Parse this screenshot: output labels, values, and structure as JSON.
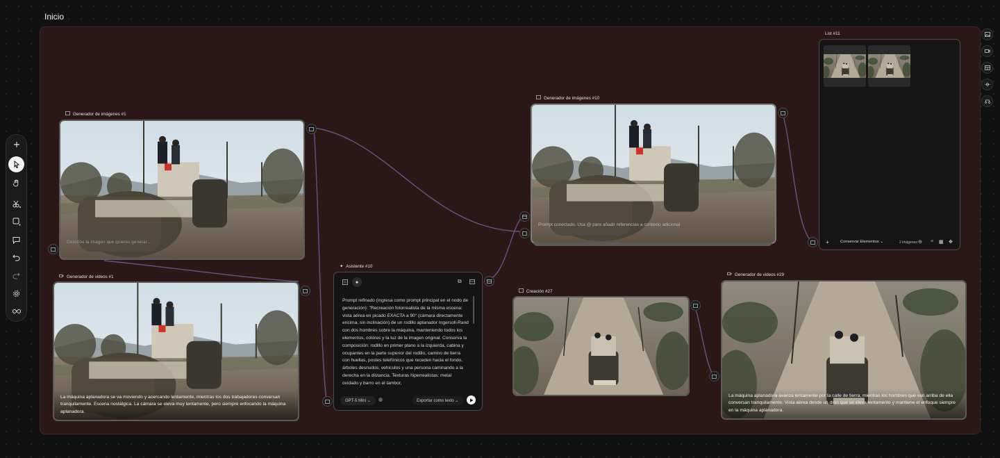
{
  "page_title": "Inicio",
  "nodes": {
    "img1": {
      "label": "Generador de imágenes #1",
      "placeholder": "Describe la imagen que quieres generar..."
    },
    "img10": {
      "label": "Generador de imágenes #10",
      "placeholder": "Prompt conectado. Usa @ para añadir referencias a contexto adicional"
    },
    "vid1": {
      "label": "Generador de videos #1",
      "caption": "La máquina aplanadora se va moviendo y acercando lentamente, mientras los dos trabajadores conversan tranquilamente. Escena nostálgica. La cámara se eleva muy lentamente, pero siempre enfocando la máquina aplanadora."
    },
    "creation27": {
      "label": "Creación #27"
    },
    "vid29": {
      "label": "Generador de videos #29",
      "caption": "La máquina aplanadora avanza lentamente por la calle de tierra, mientras los hombres que van arriba de ella conversan tranquilamente. Vista aérea desde un dron que se eleva lentamente y mantiene el enfoque siempre en la máquina aplanadora."
    }
  },
  "assistant": {
    "label": "Asistente #10",
    "text": "Prompt refinado (ingresa como prompt principal en el nodo de generación): \"Recreación fotorrealista de la misma escena: vista aérea en picado EXACTA a 90° (cámara directamente encima, sin inclinación) de un rodillo aplanador Ingersoll-Rand con dos hombres sobre la máquina, manteniendo todos los elementos, colores y la luz de la imagen original. Conserva la composición: rodillo en primer plano a la izquierda, cabina y ocupantes en la parte superior del rodillo, camino de tierra con huellas, postes telefónicos que receden hacia el fondo, árboles desnudos, vehículos y una persona caminando a la derecha en la distancia. Texturas hiperrealistas: metal oxidado y barro en el tambor,",
    "model": "GPT-5 Mini",
    "export_label": "Exportar como texto"
  },
  "list": {
    "label": "List #11",
    "keep_label": "Conservar Elementos",
    "count_label": "2 imágenes"
  },
  "icons": {
    "toolbar": [
      "plus-icon",
      "pointer-icon",
      "hand-icon",
      "scissors-icon",
      "shape-icon",
      "comment-icon",
      "undo-icon",
      "redo-icon",
      "gear-icon",
      "infinity-icon"
    ],
    "right_toolbar": [
      "image-icon",
      "video-icon",
      "layout-icon",
      "audio-icon",
      "workflow-icon"
    ]
  },
  "colors": {
    "board": "#2c1717",
    "connector": "#6b5a8e",
    "background": "#111111"
  }
}
